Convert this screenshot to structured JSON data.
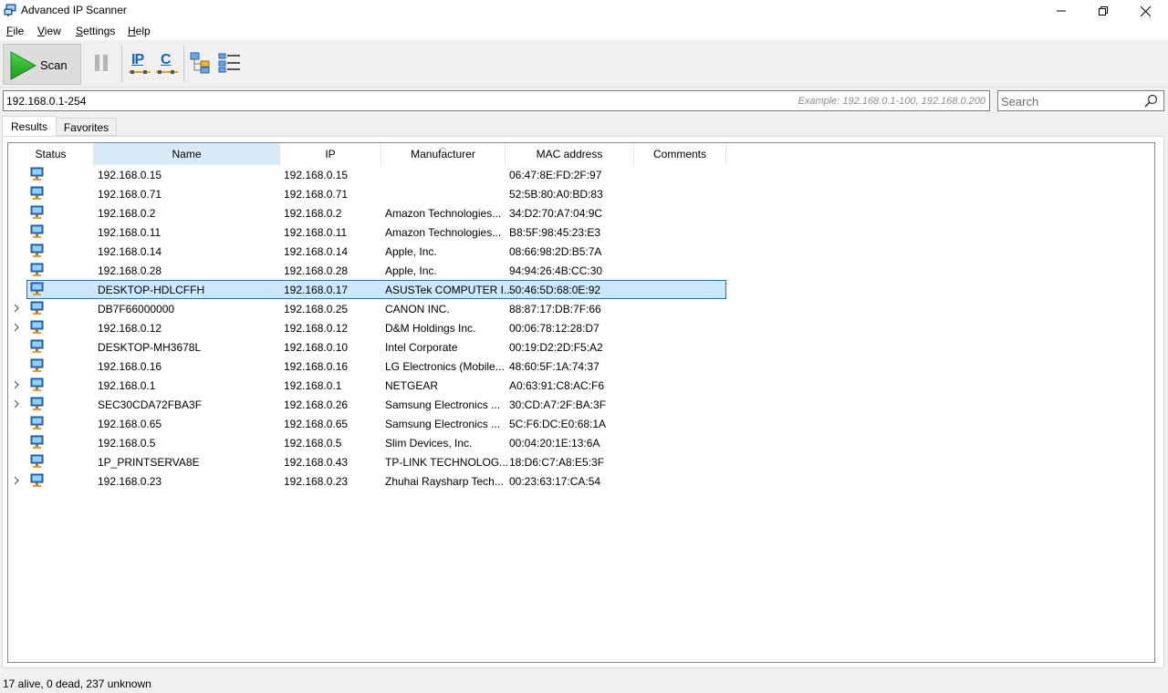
{
  "window": {
    "title": "Advanced IP Scanner"
  },
  "menu": [
    {
      "label": "File",
      "u": "F",
      "rest": "ile"
    },
    {
      "label": "View",
      "u": "V",
      "rest": "iew"
    },
    {
      "label": "Settings",
      "u": "S",
      "rest": "ettings"
    },
    {
      "label": "Help",
      "u": "H",
      "rest": "elp"
    }
  ],
  "toolbar": {
    "scan_label": "Scan",
    "ip_icon_text": "IP",
    "c_icon_text": "C"
  },
  "address": {
    "value": "192.168.0.1-254",
    "hint": "Example: 192.168.0.1-100, 192.168.0.200"
  },
  "search": {
    "placeholder": "Search"
  },
  "tabs": [
    {
      "label": "Results",
      "active": true
    },
    {
      "label": "Favorites",
      "active": false
    }
  ],
  "columns": [
    "Status",
    "Name",
    "IP",
    "Manufacturer",
    "MAC address",
    "Comments"
  ],
  "rows": [
    {
      "name": "192.168.0.15",
      "ip": "192.168.0.15",
      "manufacturer": "",
      "mac": "06:47:8E:FD:2F:97",
      "expandable": false,
      "selected": false
    },
    {
      "name": "192.168.0.71",
      "ip": "192.168.0.71",
      "manufacturer": "",
      "mac": "52:5B:80:A0:BD:83",
      "expandable": false,
      "selected": false
    },
    {
      "name": "192.168.0.2",
      "ip": "192.168.0.2",
      "manufacturer": "Amazon Technologies...",
      "mac": "34:D2:70:A7:04:9C",
      "expandable": false,
      "selected": false
    },
    {
      "name": "192.168.0.11",
      "ip": "192.168.0.11",
      "manufacturer": "Amazon Technologies...",
      "mac": "B8:5F:98:45:23:E3",
      "expandable": false,
      "selected": false
    },
    {
      "name": "192.168.0.14",
      "ip": "192.168.0.14",
      "manufacturer": "Apple, Inc.",
      "mac": "08:66:98:2D:B5:7A",
      "expandable": false,
      "selected": false
    },
    {
      "name": "192.168.0.28",
      "ip": "192.168.0.28",
      "manufacturer": "Apple, Inc.",
      "mac": "94:94:26:4B:CC:30",
      "expandable": false,
      "selected": false
    },
    {
      "name": "DESKTOP-HDLCFFH",
      "ip": "192.168.0.17",
      "manufacturer": "ASUSTek COMPUTER I...",
      "mac": "50:46:5D:68:0E:92",
      "expandable": false,
      "selected": true
    },
    {
      "name": "DB7F66000000",
      "ip": "192.168.0.25",
      "manufacturer": "CANON INC.",
      "mac": "88:87:17:DB:7F:66",
      "expandable": true,
      "selected": false
    },
    {
      "name": "192.168.0.12",
      "ip": "192.168.0.12",
      "manufacturer": "D&M Holdings Inc.",
      "mac": "00:06:78:12:28:D7",
      "expandable": true,
      "selected": false
    },
    {
      "name": "DESKTOP-MH3678L",
      "ip": "192.168.0.10",
      "manufacturer": "Intel Corporate",
      "mac": "00:19:D2:2D:F5:A2",
      "expandable": false,
      "selected": false
    },
    {
      "name": "192.168.0.16",
      "ip": "192.168.0.16",
      "manufacturer": "LG Electronics (Mobile...",
      "mac": "48:60:5F:1A:74:37",
      "expandable": false,
      "selected": false
    },
    {
      "name": "192.168.0.1",
      "ip": "192.168.0.1",
      "manufacturer": "NETGEAR",
      "mac": "A0:63:91:C8:AC:F6",
      "expandable": true,
      "selected": false
    },
    {
      "name": "SEC30CDA72FBA3F",
      "ip": "192.168.0.26",
      "manufacturer": "Samsung Electronics ...",
      "mac": "30:CD:A7:2F:BA:3F",
      "expandable": true,
      "selected": false
    },
    {
      "name": "192.168.0.65",
      "ip": "192.168.0.65",
      "manufacturer": "Samsung Electronics ...",
      "mac": "5C:F6:DC:E0:68:1A",
      "expandable": false,
      "selected": false
    },
    {
      "name": "192.168.0.5",
      "ip": "192.168.0.5",
      "manufacturer": "Slim Devices, Inc.",
      "mac": "00:04:20:1E:13:6A",
      "expandable": false,
      "selected": false
    },
    {
      "name": "1P_PRINTSERVA8E",
      "ip": "192.168.0.43",
      "manufacturer": "TP-LINK TECHNOLOG...",
      "mac": "18:D6:C7:A8:E5:3F",
      "expandable": false,
      "selected": false
    },
    {
      "name": "192.168.0.23",
      "ip": "192.168.0.23",
      "manufacturer": "Zhuhai Raysharp Tech...",
      "mac": "00:23:63:17:CA:54",
      "expandable": true,
      "selected": false
    }
  ],
  "status": {
    "text": "17 alive, 0 dead, 237 unknown"
  },
  "colors": {
    "selection_bg": "#cce8ff",
    "selection_border": "#0078d7",
    "active_column": "#d9ebf9",
    "scan_green": "#2db52d"
  }
}
